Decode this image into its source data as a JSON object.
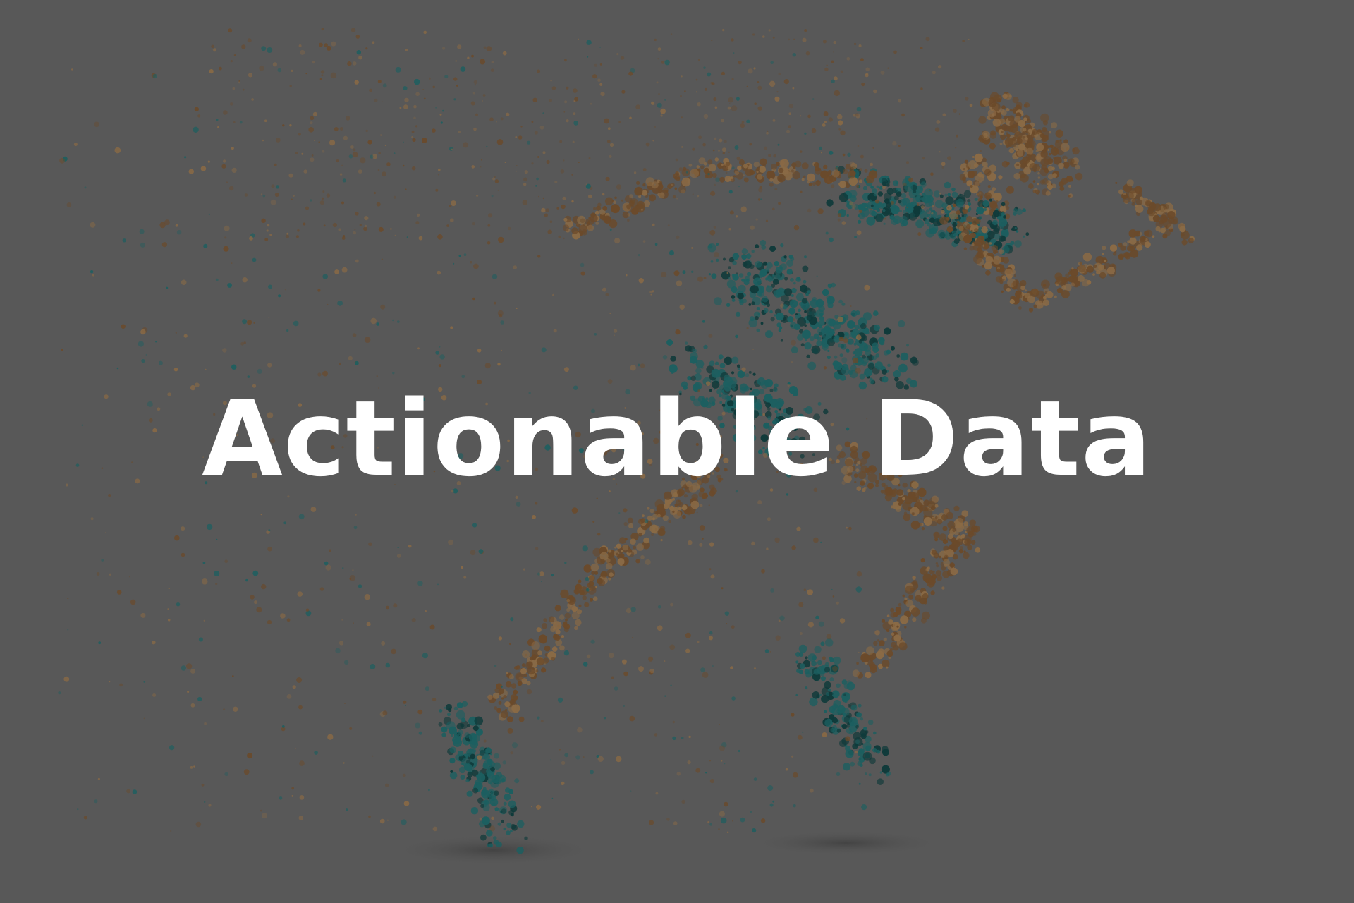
{
  "slide": {
    "title": "Actionable Data",
    "background_color": "#585858",
    "title_color": "#ffffff",
    "image": {
      "subject": "particle-runner-illustration",
      "colors": {
        "skin": "#6b4a2a",
        "skin_light": "#8a6a45",
        "outfit": "#1c5f60",
        "outfit_dark": "#0f3a3a"
      }
    }
  }
}
